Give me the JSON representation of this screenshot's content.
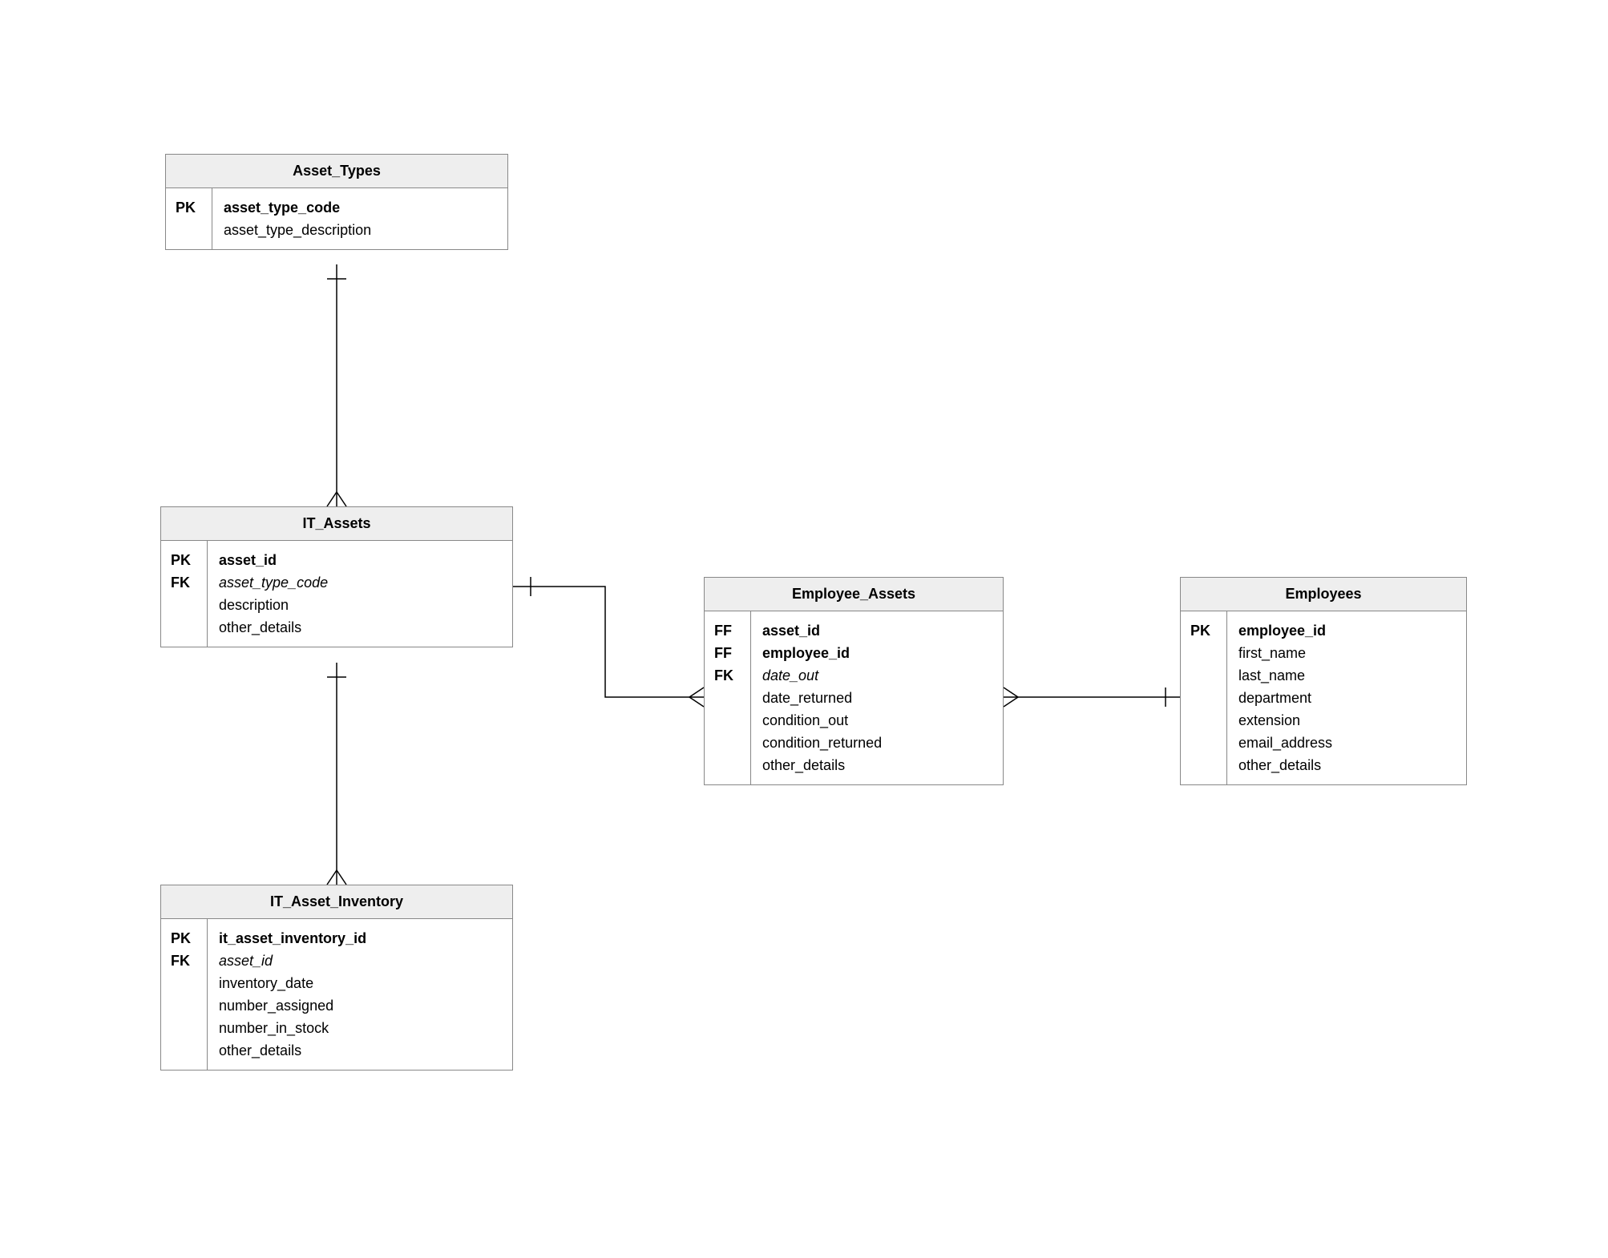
{
  "entities": {
    "asset_types": {
      "title": "Asset_Types",
      "keys": [
        "PK",
        ""
      ],
      "attrs": [
        {
          "text": "asset_type_code",
          "cls": "bold"
        },
        {
          "text": "asset_type_description",
          "cls": ""
        }
      ]
    },
    "it_assets": {
      "title": "IT_Assets",
      "keys": [
        "PK",
        "FK",
        "",
        ""
      ],
      "attrs": [
        {
          "text": "asset_id",
          "cls": "bold"
        },
        {
          "text": "asset_type_code",
          "cls": "italic"
        },
        {
          "text": "description",
          "cls": ""
        },
        {
          "text": "other_details",
          "cls": ""
        }
      ]
    },
    "it_asset_inventory": {
      "title": "IT_Asset_Inventory",
      "keys": [
        "PK",
        "FK",
        "",
        "",
        "",
        ""
      ],
      "attrs": [
        {
          "text": "it_asset_inventory_id",
          "cls": "bold"
        },
        {
          "text": "asset_id",
          "cls": "italic"
        },
        {
          "text": "inventory_date",
          "cls": ""
        },
        {
          "text": "number_assigned",
          "cls": ""
        },
        {
          "text": "number_in_stock",
          "cls": ""
        },
        {
          "text": "other_details",
          "cls": ""
        }
      ]
    },
    "employee_assets": {
      "title": "Employee_Assets",
      "keys": [
        "FF",
        "FF",
        "FK",
        "",
        "",
        "",
        ""
      ],
      "attrs": [
        {
          "text": "asset_id",
          "cls": "bold"
        },
        {
          "text": "employee_id",
          "cls": "bold"
        },
        {
          "text": "date_out",
          "cls": "italic"
        },
        {
          "text": "date_returned",
          "cls": ""
        },
        {
          "text": "condition_out",
          "cls": ""
        },
        {
          "text": "condition_returned",
          "cls": ""
        },
        {
          "text": "other_details",
          "cls": ""
        }
      ]
    },
    "employees": {
      "title": "Employees",
      "keys": [
        "PK",
        "",
        "",
        "",
        "",
        "",
        ""
      ],
      "attrs": [
        {
          "text": "employee_id",
          "cls": "bold"
        },
        {
          "text": "first_name",
          "cls": ""
        },
        {
          "text": "last_name",
          "cls": ""
        },
        {
          "text": "department",
          "cls": ""
        },
        {
          "text": "extension",
          "cls": ""
        },
        {
          "text": "email_address",
          "cls": ""
        },
        {
          "text": "other_details",
          "cls": ""
        }
      ]
    }
  }
}
